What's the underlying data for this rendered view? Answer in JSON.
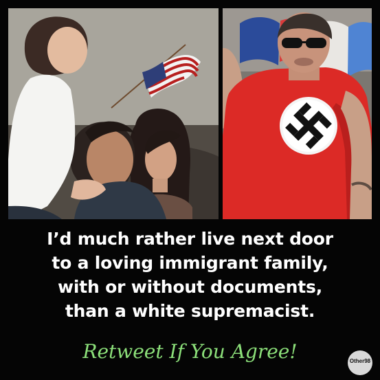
{
  "caption": {
    "lines": [
      "I’d much rather live next door",
      "to a loving immigrant family,",
      "with or without documents,",
      "than a white supremacist."
    ],
    "call_to_action": "Retweet If You Agree!"
  },
  "logo": {
    "text": "Other98"
  },
  "colors": {
    "background": "#050505",
    "caption_text": "#ffffff",
    "call_to_action_text": "#8ce07a",
    "shirt_red": "#dc2a26"
  }
}
